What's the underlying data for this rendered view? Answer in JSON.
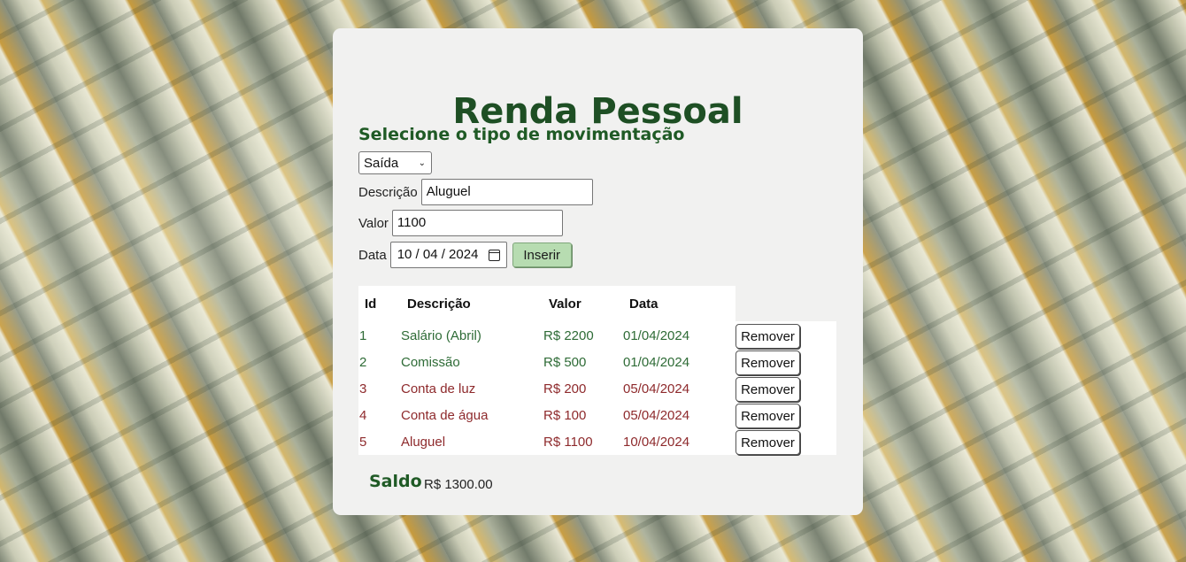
{
  "header": {
    "title": "Renda Pessoal"
  },
  "form": {
    "section_title": "Selecione o tipo de movimentação",
    "type_selected": "Saída",
    "description_label": "Descrição",
    "description_value": "Aluguel",
    "value_label": "Valor",
    "value_value": "1100",
    "date_label": "Data",
    "date_value": "10 / 04 / 2024",
    "insert_button": "Inserir"
  },
  "table": {
    "headers": {
      "id": "Id",
      "description": "Descrição",
      "value": "Valor",
      "date": "Data"
    },
    "remove_label": "Remover",
    "rows": [
      {
        "id": "1",
        "description": "Salário (Abril)",
        "value": "R$ 2200",
        "date": "01/04/2024",
        "kind": "entrada"
      },
      {
        "id": "2",
        "description": "Comissão",
        "value": "R$ 500",
        "date": "01/04/2024",
        "kind": "entrada"
      },
      {
        "id": "3",
        "description": "Conta de luz",
        "value": "R$ 200",
        "date": "05/04/2024",
        "kind": "saida"
      },
      {
        "id": "4",
        "description": "Conta de água",
        "value": "R$ 100",
        "date": "05/04/2024",
        "kind": "saida"
      },
      {
        "id": "5",
        "description": "Aluguel",
        "value": "R$ 1100",
        "date": "10/04/2024",
        "kind": "saida"
      }
    ]
  },
  "summary": {
    "label": "Saldo",
    "value": "R$ 1300.00"
  },
  "colors": {
    "entrada": "#2e6b36",
    "saida": "#8e2a2c",
    "title": "#1e4f24",
    "insert_button": "#b7dcb1"
  }
}
